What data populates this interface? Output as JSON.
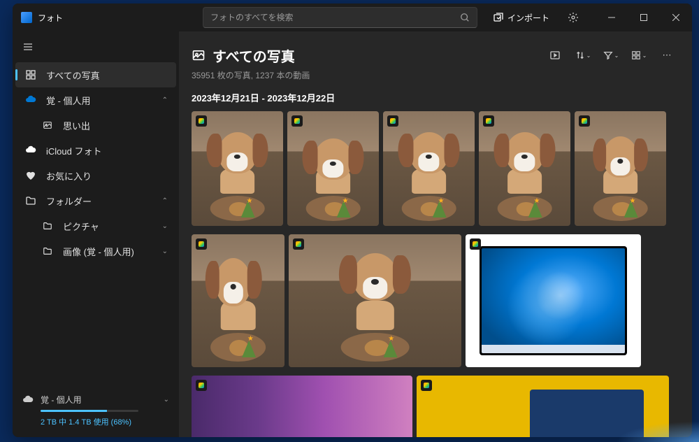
{
  "app": {
    "title": "フォト"
  },
  "search": {
    "placeholder": "フォトのすべてを検索"
  },
  "titlebar": {
    "import_label": "インポート"
  },
  "sidebar": {
    "items": [
      {
        "icon": "grid",
        "label": "すべての写真",
        "selected": true
      },
      {
        "icon": "cloud",
        "label": "覚 - 個人用",
        "expandable": true,
        "expanded": true
      },
      {
        "icon": "sparkle",
        "label": "思い出",
        "sub": true
      },
      {
        "icon": "icloud",
        "label": "iCloud フォト"
      },
      {
        "icon": "heart",
        "label": "お気に入り"
      },
      {
        "icon": "folder",
        "label": "フォルダー",
        "expandable": true,
        "expanded": true
      },
      {
        "icon": "folder",
        "label": "ピクチャ",
        "sub": true,
        "expandable": true
      },
      {
        "icon": "folder",
        "label": "画像 (覚 - 個人用)",
        "sub": true,
        "expandable": true
      }
    ],
    "storage": {
      "account_label": "覚 - 個人用",
      "usage_text": "2 TB 中 1.4 TB 使用 (68%)",
      "percent": 68
    }
  },
  "main": {
    "title": "すべての写真",
    "subtitle": "35951 枚の写真, 1237 本の動画",
    "date_header": "2023年12月21日 - 2023年12月22日"
  }
}
